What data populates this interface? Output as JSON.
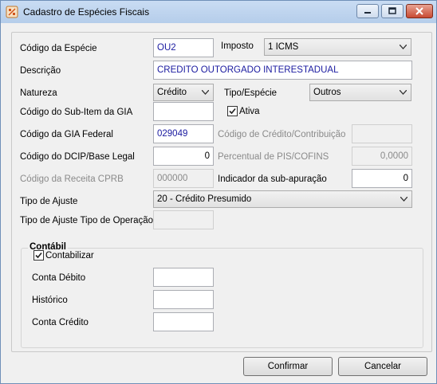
{
  "window": {
    "title": "Cadastro de Espécies Fiscais",
    "minimize_label": "minimize",
    "maximize_label": "maximize",
    "close_label": "close"
  },
  "form": {
    "codigo_especie": {
      "label": "Código da Espécie",
      "value": "OU2"
    },
    "imposto": {
      "label": "Imposto",
      "value": "1 ICMS"
    },
    "descricao": {
      "label": "Descrição",
      "value": "CREDITO OUTORGADO INTERESTADUAL"
    },
    "natureza": {
      "label": "Natureza",
      "value": "Crédito"
    },
    "tipo_especie": {
      "label": "Tipo/Espécie",
      "value": "Outros"
    },
    "sub_item_gia": {
      "label": "Código do Sub-Item da GIA",
      "value": ""
    },
    "ativa": {
      "label": "Ativa",
      "checked": true
    },
    "gia_federal": {
      "label": "Código da GIA Federal",
      "value": "029049"
    },
    "credito_contribuicao": {
      "label": "Código de Crédito/Contribuição",
      "value": ""
    },
    "dcip_base_legal": {
      "label": "Código do DCIP/Base Legal",
      "value": "0"
    },
    "percentual_pis_cofins": {
      "label": "Percentual de PIS/COFINS",
      "value": "0,0000"
    },
    "receita_cprb": {
      "label": "Código da Receita CPRB",
      "value": "000000"
    },
    "indicador_sub_apuracao": {
      "label": "Indicador da sub-apuração",
      "value": "0"
    },
    "tipo_ajuste": {
      "label": "Tipo de Ajuste",
      "value": "20 - Crédito Presumido"
    },
    "tipo_ajuste_operacao": {
      "label": "Tipo de Ajuste Tipo de Operação",
      "value": ""
    }
  },
  "contabil": {
    "title": "Contábil",
    "contabilizar": {
      "label": "Contabilizar",
      "checked": true
    },
    "conta_debito": {
      "label": "Conta Débito",
      "value": ""
    },
    "historico": {
      "label": "Histórico",
      "value": ""
    },
    "conta_credito": {
      "label": "Conta Crédito",
      "value": ""
    }
  },
  "buttons": {
    "confirmar": "Confirmar",
    "cancelar": "Cancelar"
  },
  "colors": {
    "title_bar": "#bcd2ee",
    "window_bg": "#f0f0f0",
    "value_text": "#1a1aa0",
    "close_button": "#c84a33"
  }
}
